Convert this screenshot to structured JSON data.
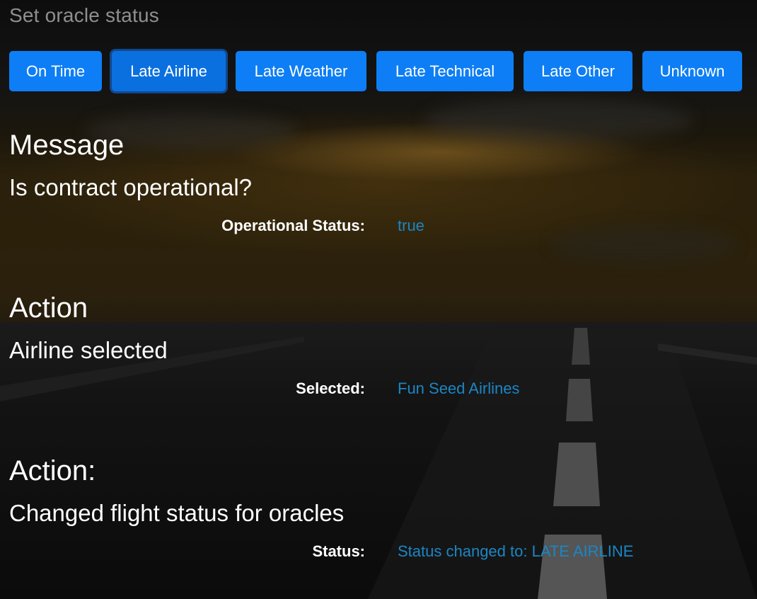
{
  "header": {
    "title": "Set oracle status"
  },
  "status_buttons": [
    {
      "label": "On Time",
      "active": false
    },
    {
      "label": "Late Airline",
      "active": true
    },
    {
      "label": "Late Weather",
      "active": false
    },
    {
      "label": "Late Technical",
      "active": false
    },
    {
      "label": "Late Other",
      "active": false
    },
    {
      "label": "Unknown",
      "active": false
    }
  ],
  "sections": [
    {
      "heading": "Message",
      "subheading": "Is contract operational?",
      "field_label": "Operational Status:",
      "field_value": "true"
    },
    {
      "heading": "Action",
      "subheading": "Airline selected",
      "field_label": "Selected:",
      "field_value": "Fun Seed Airlines"
    },
    {
      "heading": "Action:",
      "subheading": "Changed flight status for oracles",
      "field_label": "Status:",
      "field_value": "Status changed to: LATE AIRLINE"
    }
  ],
  "colors": {
    "button": "#0d7ef5",
    "value_text": "#1b86c4",
    "title_text": "#8f8f8f"
  }
}
